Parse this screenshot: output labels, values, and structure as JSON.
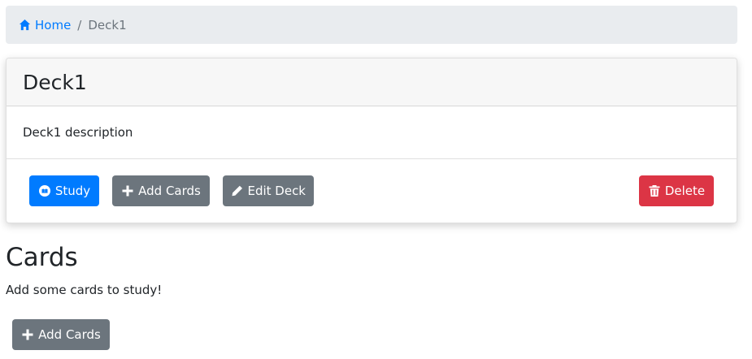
{
  "breadcrumb": {
    "home_label": "Home",
    "separator": "/",
    "current": "Deck1"
  },
  "deck": {
    "title": "Deck1",
    "description": "Deck1 description",
    "actions": {
      "study_label": "Study",
      "add_cards_label": "Add Cards",
      "edit_deck_label": "Edit Deck",
      "delete_label": "Delete"
    }
  },
  "cards_section": {
    "heading": "Cards",
    "empty_message": "Add some cards to study!",
    "add_cards_label": "Add Cards"
  },
  "icons": {
    "home": "home-icon",
    "study": "book-icon",
    "add": "plus-icon",
    "edit": "pencil-icon",
    "delete": "trash-icon"
  },
  "colors": {
    "primary": "#007bff",
    "secondary": "#6c757d",
    "danger": "#dc3545",
    "breadcrumb_bg": "#e9ecef"
  }
}
